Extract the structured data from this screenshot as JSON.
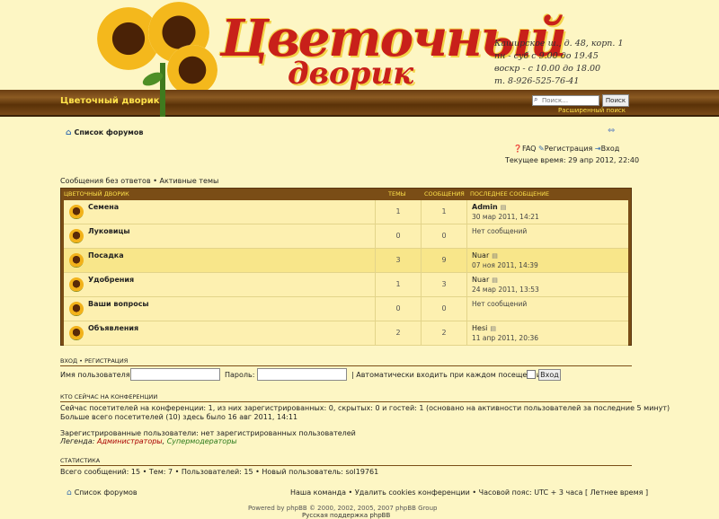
{
  "header": {
    "logo_title": "Цветочный",
    "logo_subtitle": "дворик",
    "contact_lines": [
      "Каширское ш., д. 48, корп. 1",
      "пн - суб с 9.00 до 19.45",
      "воскр - с 10.00 до 18.00",
      "т. 8-926-525-76-41"
    ],
    "site_name": "Цветочный дворик",
    "search_placeholder": "Поиск…",
    "search_button": "Поиск",
    "advanced_search": "Расширенный поиск"
  },
  "nav": {
    "forum_index": "Список форумов",
    "faq": "FAQ",
    "register": "Регистрация",
    "login": "Вход",
    "current_time": "Текущее время: 29 апр 2012, 22:40",
    "unanswered": "Сообщения без ответов",
    "active": "Активные темы"
  },
  "forum": {
    "headers": {
      "name": "Цветочный дворик",
      "topics": "Темы",
      "posts": "Сообщения",
      "last_post": "Последнее сообщение"
    },
    "rows": [
      {
        "name": "Семена",
        "topics": "1",
        "posts": "1",
        "author": "Admin",
        "date": "30 мар 2011, 14:21"
      },
      {
        "name": "Луковицы",
        "topics": "0",
        "posts": "0",
        "none": "Нет сообщений"
      },
      {
        "name": "Посадка",
        "topics": "3",
        "posts": "9",
        "author": "Nuar",
        "date": "07 ноя 2011, 14:39"
      },
      {
        "name": "Удобрения",
        "topics": "1",
        "posts": "3",
        "author": "Nuar",
        "date": "24 мар 2011, 13:53"
      },
      {
        "name": "Ваши вопросы",
        "topics": "0",
        "posts": "0",
        "none": "Нет сообщений"
      },
      {
        "name": "Объявления",
        "topics": "2",
        "posts": "2",
        "author": "Hesi",
        "date": "11 апр 2011, 20:36"
      }
    ]
  },
  "login": {
    "title": "Вход • Регистрация",
    "username_label": "Имя пользователя:",
    "password_label": "Пароль:",
    "autologin_label": "| Автоматически входить при каждом посещении",
    "login_button": "Вход"
  },
  "online": {
    "title": "Кто сейчас на конференции",
    "line1": "Сейчас посетителей на конференции: 1, из них зарегистрированных: 0, скрытых: 0 и гостей: 1 (основано на активности пользователей за последние 5 минут)",
    "line2": "Больше всего посетителей (10) здесь было 16 авг 2011, 14:11",
    "registered": "Зарегистрированные пользователи: нет зарегистрированных пользователей",
    "legend_prefix": "Легенда:",
    "legend_admins": "Администраторы",
    "legend_sep": ",",
    "legend_mods": "Супермодераторы"
  },
  "stats": {
    "title": "Статистика",
    "line": "Всего сообщений: 15 • Тем: 7 • Пользователей: 15 • Новый пользователь: sol19761"
  },
  "footer": {
    "home": "Список форумов",
    "links": "Наша команда • Удалить cookies конференции • Часовой пояс: UTC + 3 часа [ Летнее время ]",
    "powered": "Powered by phpBB © 2000, 2002, 2005, 2007 phpBB Group",
    "support": "Русская поддержка phpBB"
  },
  "colors": {
    "background": "#fdf6c4",
    "wood": "#7a4d16",
    "accent_yellow": "#ffe24a",
    "admin_red": "#aa0000",
    "mod_green": "#2a7a1a"
  }
}
